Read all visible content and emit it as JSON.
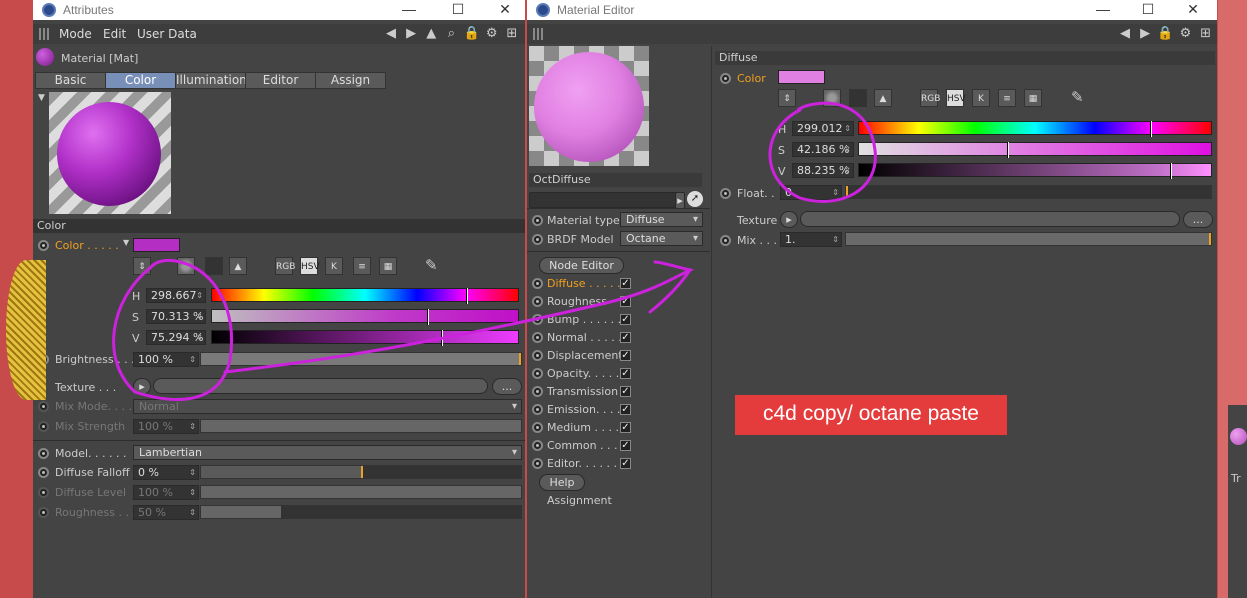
{
  "attributes": {
    "title": "Attributes",
    "menu": [
      "Mode",
      "Edit",
      "User Data"
    ],
    "material_name": "Material [Mat]",
    "tabs": [
      {
        "label": "Basic",
        "active": false
      },
      {
        "label": "Color",
        "active": true
      },
      {
        "label": "Illumination",
        "active": false
      },
      {
        "label": "Editor",
        "active": false
      },
      {
        "label": "Assign",
        "active": false
      }
    ],
    "section_color": "Color",
    "color_label": "Color . . . . .",
    "color_swatch": "#b42ec4",
    "mode_icons": [
      "RGB",
      "HSV",
      "K"
    ],
    "h_label": "H",
    "h_value": "298.667",
    "s_label": "S",
    "s_value": "70.313 %",
    "v_label": "V",
    "v_value": "75.294 %",
    "brightness_label": "Brightness . . .",
    "brightness_value": "100 %",
    "texture_label": "Texture . . .",
    "texture_btn": "...",
    "mix_mode_label": "Mix Mode. . . .",
    "mix_mode_value": "Normal",
    "mix_strength_label": "Mix Strength",
    "mix_strength_value": "100 %",
    "model_label": "Model. . . . . .",
    "model_value": "Lambertian",
    "diffuse_falloff_label": "Diffuse Falloff",
    "diffuse_falloff_value": "0 %",
    "diffuse_level_label": "Diffuse Level",
    "diffuse_level_value": "100 %",
    "roughness_label": "Roughness . .",
    "roughness_value": "50 %"
  },
  "material_editor": {
    "title": "Material Editor",
    "material_label": "OctDiffuse",
    "material_type_label": "Material type",
    "material_type_value": "Diffuse",
    "brdf_label": "BRDF Model",
    "brdf_value": "Octane",
    "node_editor_btn": "Node Editor",
    "channels": [
      {
        "label": "Diffuse . . . . .",
        "active": true
      },
      {
        "label": "Roughness",
        "active": false
      },
      {
        "label": "Bump . . . . . .",
        "active": false
      },
      {
        "label": "Normal . . . . .",
        "active": false
      },
      {
        "label": "Displacement",
        "active": false
      },
      {
        "label": "Opacity. . . . .",
        "active": false
      },
      {
        "label": "Transmission",
        "active": false
      },
      {
        "label": "Emission. . . . .",
        "active": false
      },
      {
        "label": "Medium . . . . .",
        "active": false
      },
      {
        "label": "Common . . . .",
        "active": false
      },
      {
        "label": "Editor. . . . . .",
        "active": false
      }
    ],
    "help_btn": "Help",
    "assignment_label": "Assignment",
    "diffuse_header": "Diffuse",
    "color_label": "Color",
    "color_swatch": "#e080e2",
    "mode_icons": [
      "RGB",
      "HSV",
      "K"
    ],
    "h_label": "H",
    "h_value": "299.012",
    "s_label": "S",
    "s_value": "42.186 %",
    "v_label": "V",
    "v_value": "88.235 %",
    "float_label": "Float. .",
    "float_value": "0",
    "texture_label": "Texture",
    "texture_btn": "...",
    "mix_label": "Mix . . .",
    "mix_value": "1."
  },
  "annotation": {
    "banner": "c4d copy/ octane paste",
    "color": "#cc22dd"
  },
  "right_strip": {
    "tab_label": "Tr"
  }
}
